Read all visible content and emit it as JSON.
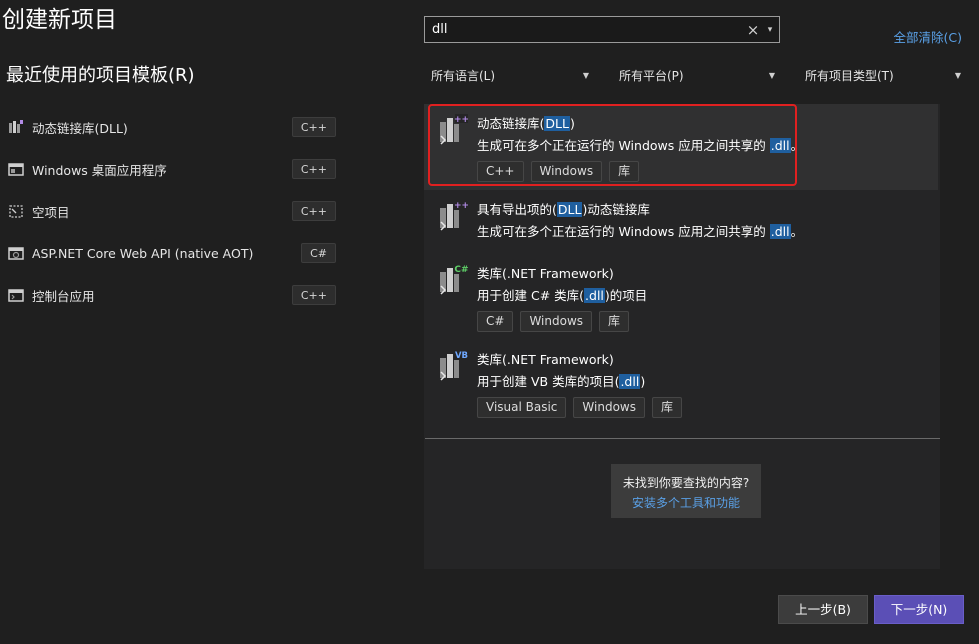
{
  "page": {
    "title": "创建新项目",
    "recent_title": "最近使用的项目模板(R)"
  },
  "recent_templates": [
    {
      "label": "动态链接库(DLL)",
      "tag": "C++",
      "icon": "dll-project-icon"
    },
    {
      "label": "Windows 桌面应用程序",
      "tag": "C++",
      "icon": "windows-desktop-app-icon"
    },
    {
      "label": "空项目",
      "tag": "C++",
      "icon": "empty-project-icon"
    },
    {
      "label": "ASP.NET Core Web API (native AOT)",
      "tag": "C#",
      "icon": "web-api-icon"
    },
    {
      "label": "控制台应用",
      "tag": "C++",
      "icon": "console-app-icon"
    }
  ],
  "search": {
    "value": "dll",
    "clear_icon": "×",
    "dropdown_icon": "▾",
    "clear_all": "全部清除(C)"
  },
  "filters": {
    "language": "所有语言(L)",
    "platform": "所有平台(P)",
    "project_type": "所有项目类型(T)"
  },
  "results": [
    {
      "name_prefix": "动态链接库(",
      "name_hl": "DLL",
      "name_suffix": ")",
      "desc_prefix": "生成可在多个正在运行的 Windows 应用之间共享的 ",
      "desc_hl": ".dll",
      "desc_suffix": "。",
      "tags": [
        "C++",
        "Windows",
        "库"
      ],
      "badge": "++",
      "selected": true
    },
    {
      "name_prefix": "具有导出项的(",
      "name_hl": "DLL",
      "name_suffix": ")动态链接库",
      "desc_prefix": "生成可在多个正在运行的 Windows 应用之间共享的 ",
      "desc_hl": ".dll",
      "desc_suffix": "。",
      "tags": [],
      "badge": "++",
      "selected": false
    },
    {
      "name_prefix": "类库(.NET Framework)",
      "name_hl": "",
      "name_suffix": "",
      "desc_prefix": "用于创建 C# 类库(",
      "desc_hl": ".dll",
      "desc_suffix": ")的项目",
      "tags": [
        "C#",
        "Windows",
        "库"
      ],
      "badge": "C#",
      "selected": false
    },
    {
      "name_prefix": "类库(.NET Framework)",
      "name_hl": "",
      "name_suffix": "",
      "desc_prefix": "用于创建 VB 类库的项目(",
      "desc_hl": ".dll",
      "desc_suffix": ")",
      "tags": [
        "Visual Basic",
        "Windows",
        "库"
      ],
      "badge": "VB",
      "selected": false
    }
  ],
  "not_found": {
    "text": "未找到你要查找的内容?",
    "link": "安装多个工具和功能"
  },
  "buttons": {
    "back": "上一步(B)",
    "next": "下一步(N)"
  },
  "colors": {
    "background": "#1f1f1f",
    "panel": "#252526",
    "accent": "#5b4fb6",
    "link": "#5aa0e6",
    "match_highlight": "#1f5f9f",
    "selection_frame": "#e02020"
  }
}
